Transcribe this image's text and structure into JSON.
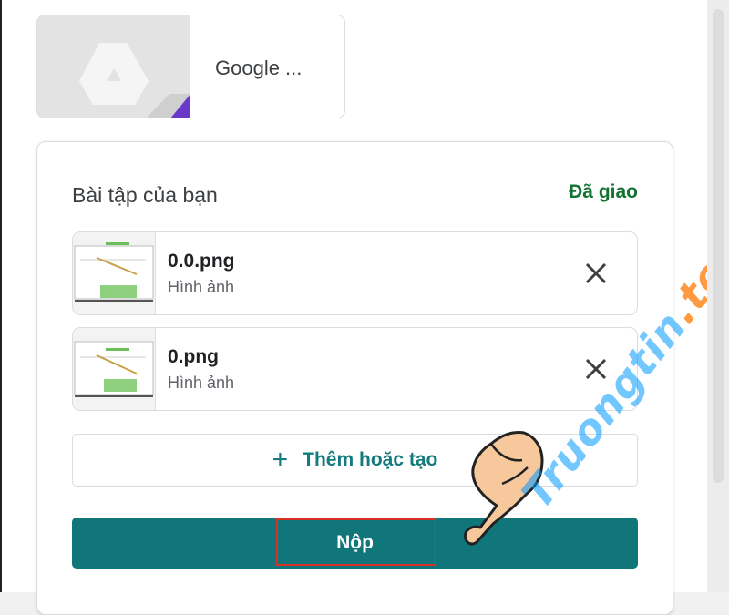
{
  "attachment": {
    "title": "Google ..."
  },
  "work": {
    "title": "Bài tập của bạn",
    "status": "Đã giao",
    "files": [
      {
        "name": "0.0.png",
        "type": "Hình ảnh"
      },
      {
        "name": "0.png",
        "type": "Hình ảnh"
      }
    ],
    "add_label": "Thêm hoặc tạo",
    "submit_label": "Nộp"
  },
  "watermark": {
    "main": "Truongtin",
    "suffix": ".top"
  },
  "colors": {
    "accent": "#11767a",
    "status": "#137333",
    "highlight": "#d93025"
  },
  "icons": {
    "drive": "google-drive-icon",
    "remove": "close-icon",
    "add": "plus-icon",
    "pointer": "hand-pointer-icon"
  }
}
